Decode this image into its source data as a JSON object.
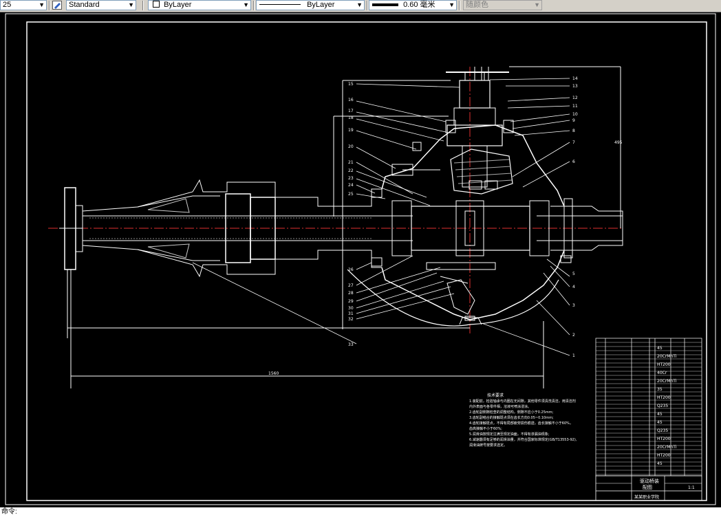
{
  "toolbar": {
    "layer_dropdown_value": "25",
    "textstyle_value": "Standard",
    "color_value": "ByLayer",
    "linetype_value": "ByLayer",
    "lineweight_value": "0.60 毫米",
    "plotstyle_value": "随颜色"
  },
  "drawing": {
    "part_labels_right": [
      "14",
      "13",
      "12",
      "11",
      "10",
      "9",
      "8",
      "7",
      "6",
      "5",
      "4",
      "3",
      "2",
      "1"
    ],
    "part_labels_left": [
      "15",
      "16",
      "17",
      "18",
      "19",
      "20",
      "21",
      "22",
      "23",
      "24",
      "25",
      "26",
      "27",
      "28",
      "29",
      "30",
      "31",
      "32",
      "33"
    ],
    "notes_title": "技术要求",
    "notes": [
      "1.装配前，检验轴承与内圈在无间隙，其他零件须清洗清洁，用清洁剂",
      "内外表面与各零件相，溶液可喷涂浸涂。",
      "2.齿轮副侧隙检查的调整结构，侧隙不应小于0.25mm;",
      "3.齿轮副啮合的接触斑点须在齿长方向0.05~0.10mm;",
      "4.齿轮接触斑点，不得有局部疲劳损伤痕迹，齿长接触不小于60%，",
      "齿高接触不小于60%;",
      "5.润滑油按规定注满至规定油面，不得有渗漏油现象;",
      "6.减速器须有足够的润滑油量，并符合国家标准规定(GB/T13553-92),",
      "润滑油牌号按要求选定。"
    ],
    "title_block": {
      "name": "驱动桥装",
      "subname": "配图",
      "school": "某某职业学院",
      "scale": "1:1"
    },
    "bom_materials": [
      "45",
      "20CrMnTi",
      "HT200",
      "40Cr",
      "20CrMnTi",
      "35",
      "HT200",
      "Q235",
      "45",
      "45",
      "Q235",
      "HT200",
      "20CrMnTi",
      "HT200",
      "45"
    ]
  },
  "command_line": "命令:"
}
